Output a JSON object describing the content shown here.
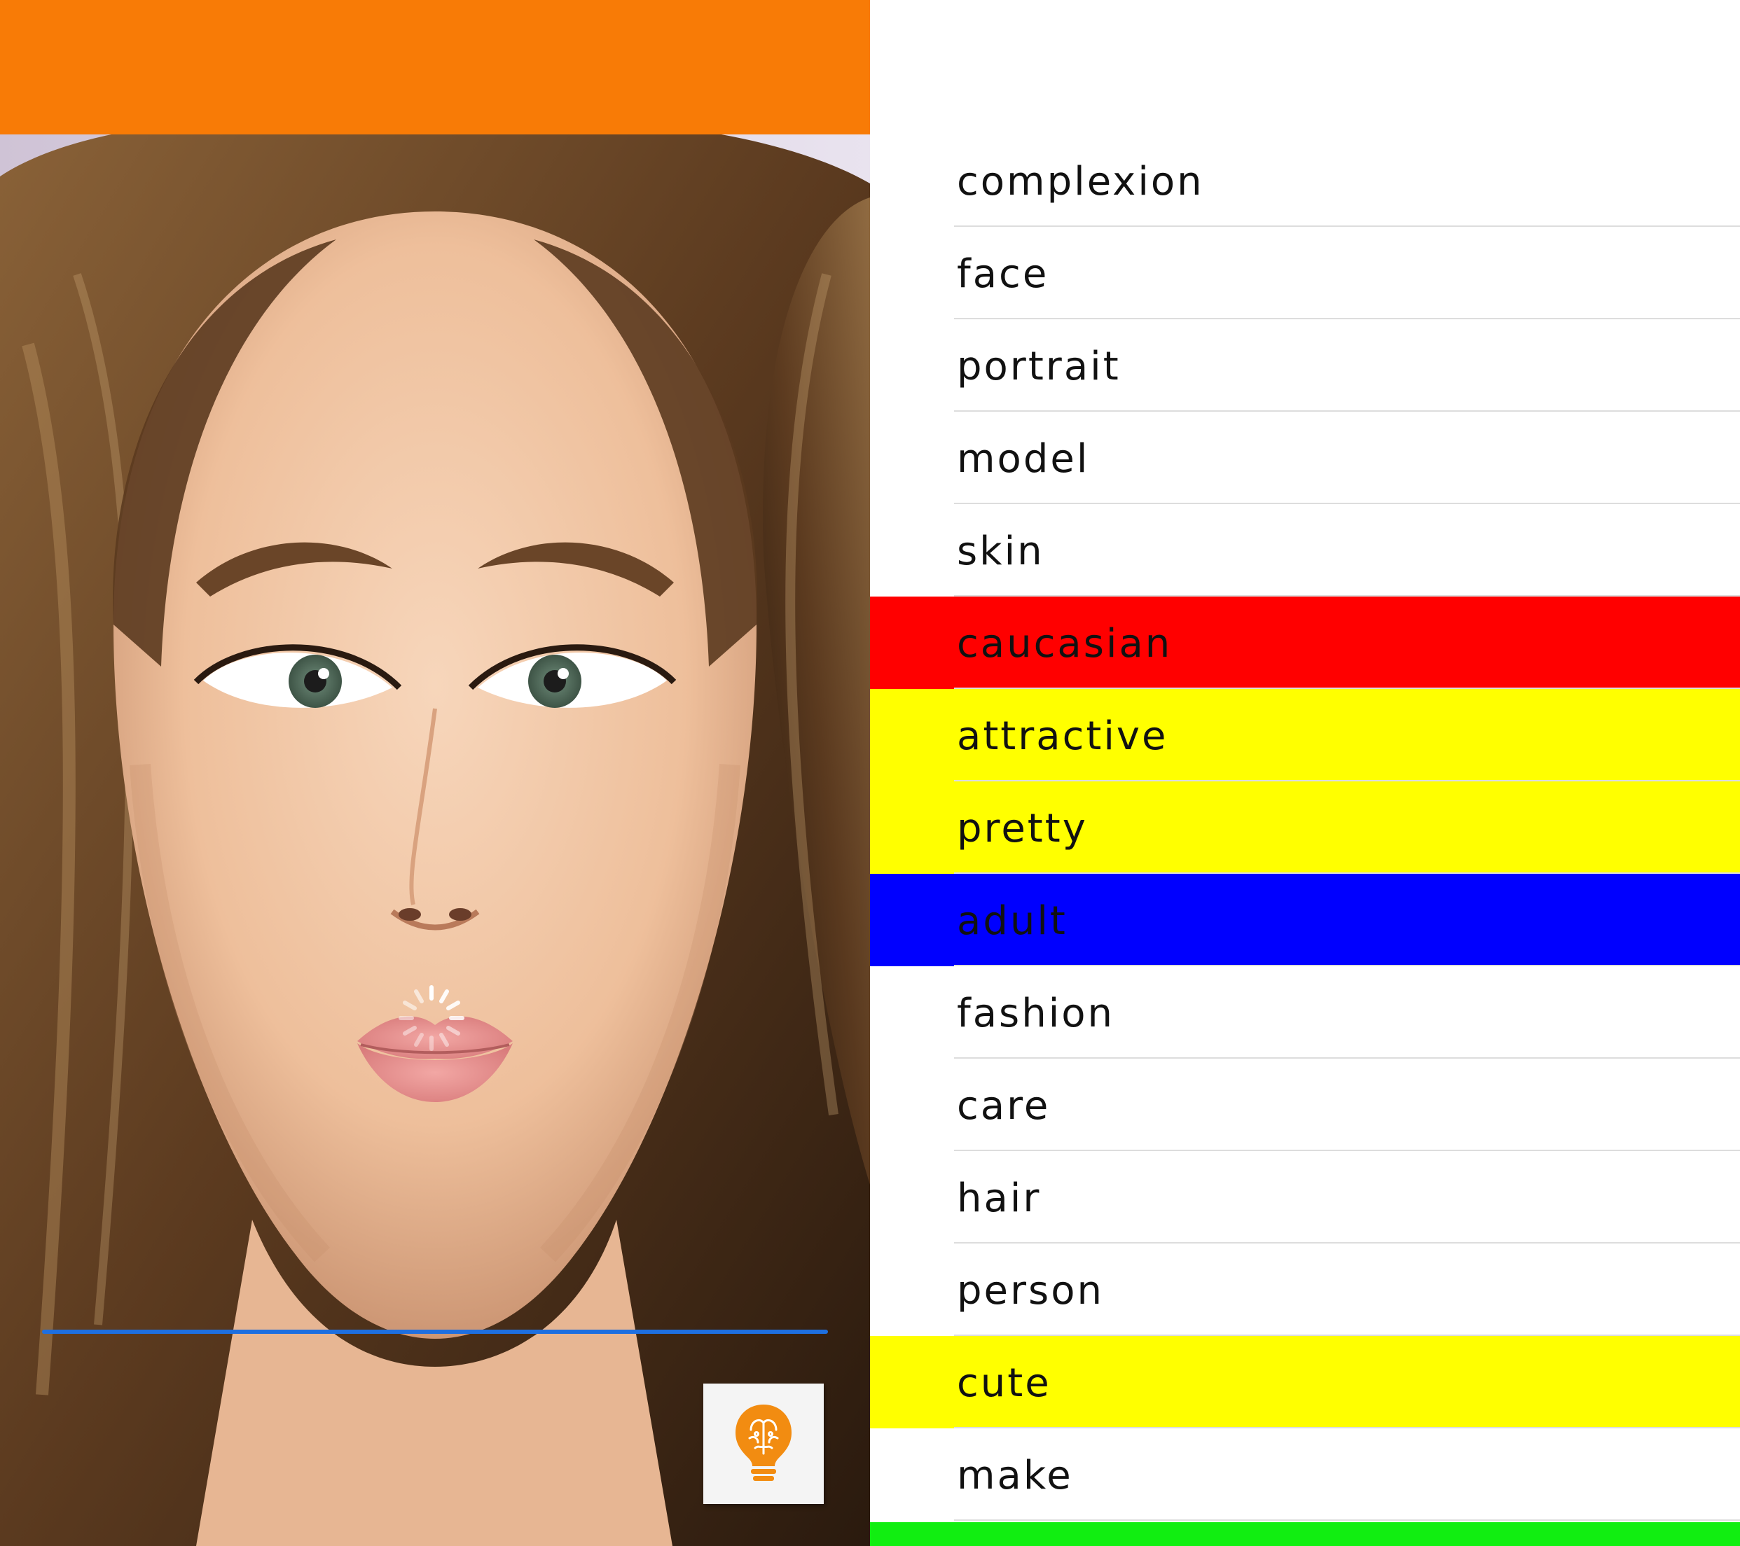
{
  "header": {
    "bar_color": "#f87b06"
  },
  "photo": {
    "subject": "portrait-photo",
    "loading": true,
    "progress_line_color": "#1e6fe0"
  },
  "badge": {
    "icon": "brain-lightbulb-icon",
    "color": "#f28c11"
  },
  "tags": [
    {
      "label": "complexion",
      "highlight": "#ffffff"
    },
    {
      "label": "face",
      "highlight": "#ffffff"
    },
    {
      "label": "portrait",
      "highlight": "#ffffff"
    },
    {
      "label": "model",
      "highlight": "#ffffff"
    },
    {
      "label": "skin",
      "highlight": "#ffffff"
    },
    {
      "label": "caucasian",
      "highlight": "#ff0000"
    },
    {
      "label": "attractive",
      "highlight": "#ffff00"
    },
    {
      "label": "pretty",
      "highlight": "#ffff00"
    },
    {
      "label": "adult",
      "highlight": "#0000ff"
    },
    {
      "label": "fashion",
      "highlight": "#ffffff"
    },
    {
      "label": "care",
      "highlight": "#ffffff"
    },
    {
      "label": "hair",
      "highlight": "#ffffff"
    },
    {
      "label": "person",
      "highlight": "#ffffff"
    },
    {
      "label": "cute",
      "highlight": "#ffff00"
    },
    {
      "label": "make",
      "highlight": "#ffffff"
    }
  ],
  "bottom_strip_color": "#11ee11"
}
